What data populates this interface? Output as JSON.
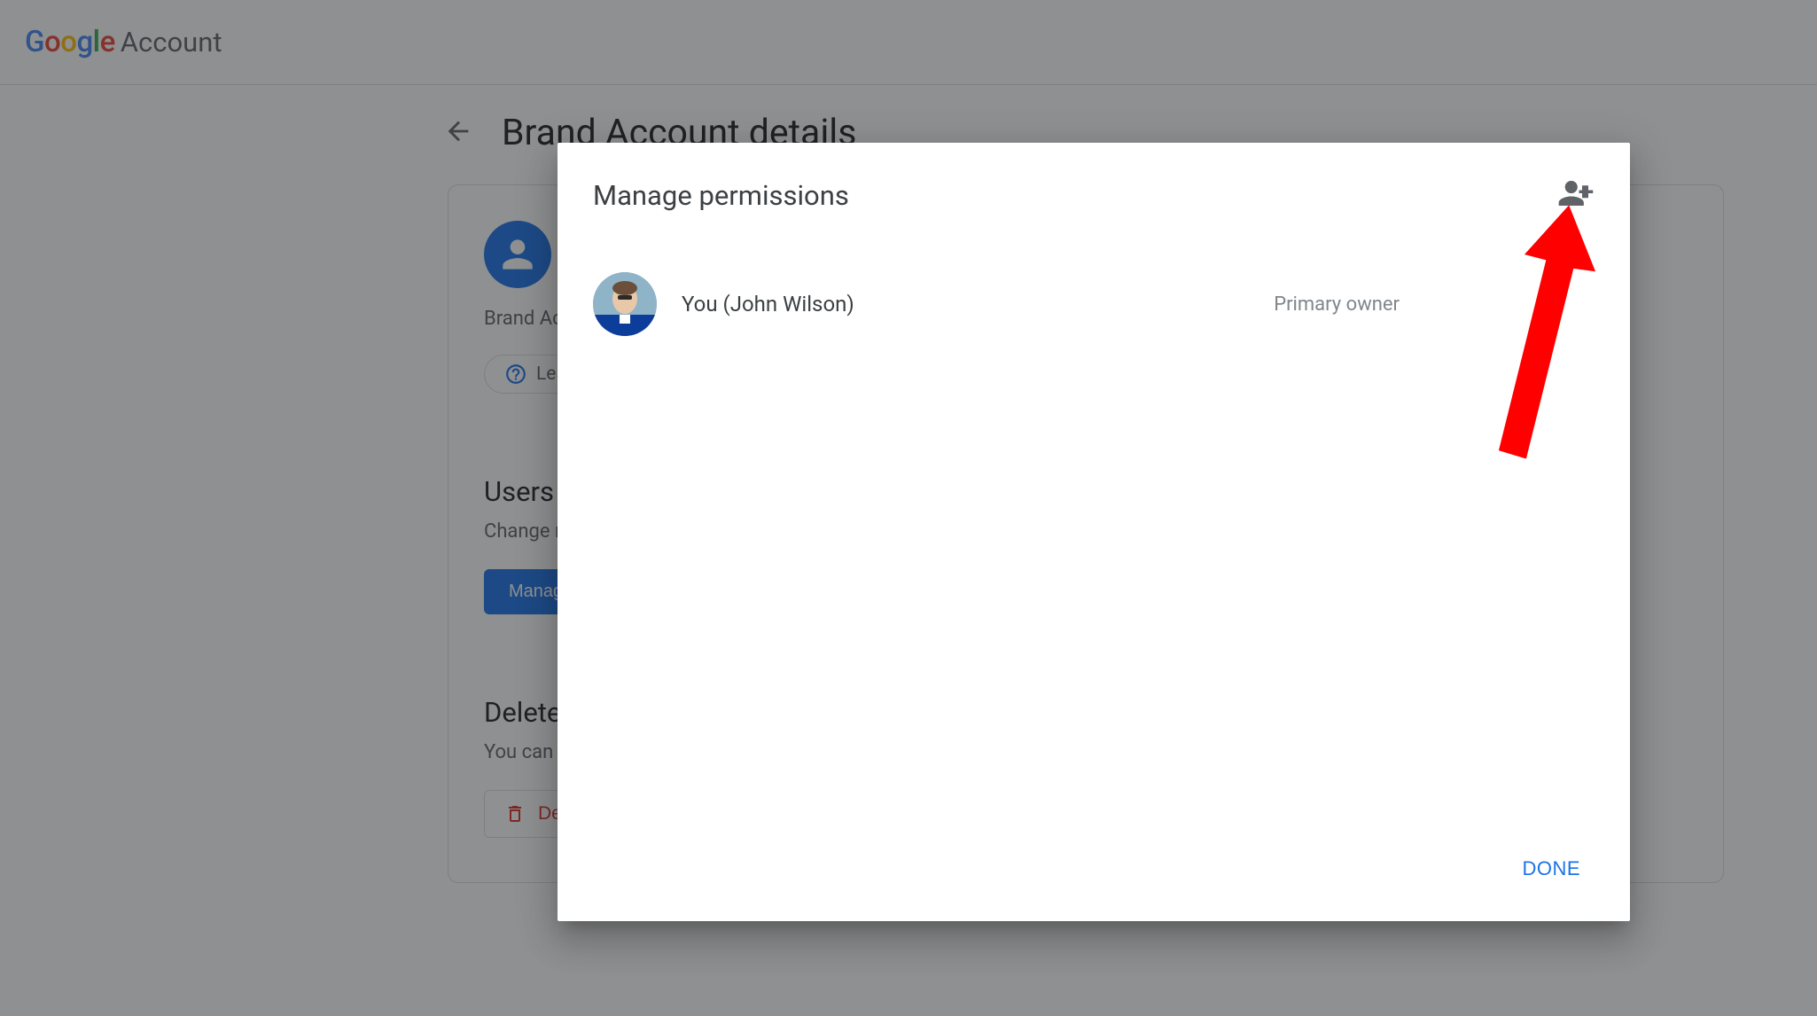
{
  "header": {
    "logo_text": "Google",
    "account_text": "Account"
  },
  "page": {
    "title": "Brand Account details",
    "brand_label": "Brand Account",
    "learn_more": "Learn more",
    "users_section_title": "Users",
    "users_section_desc": "Change roles, invite and remove users",
    "manage_button": "Manage permissions",
    "delete_section_title": "Delete account",
    "delete_section_desc": "You can delete this Brand Account and all its content",
    "delete_button": "Delete account"
  },
  "dialog": {
    "title": "Manage permissions",
    "user": {
      "name": "You (John Wilson)",
      "role": "Primary owner"
    },
    "done_button": "DONE"
  }
}
